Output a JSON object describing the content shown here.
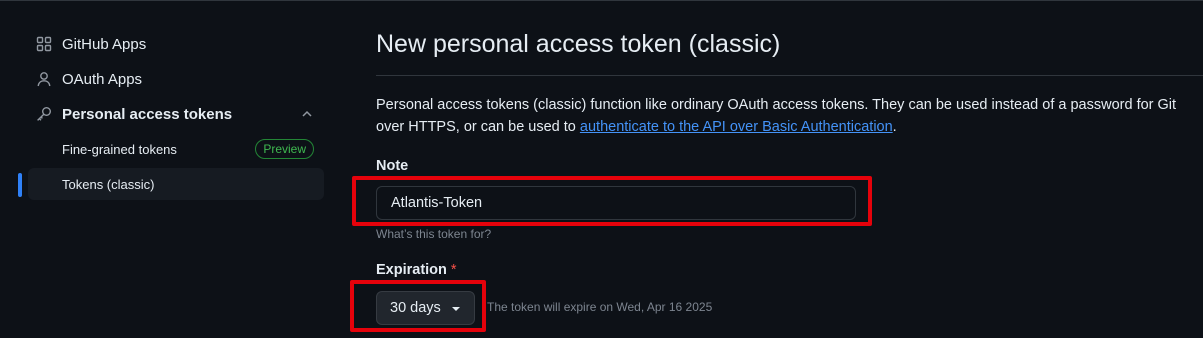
{
  "sidebar": {
    "items": [
      {
        "label": "GitHub Apps",
        "icon": "apps-grid-icon"
      },
      {
        "label": "OAuth Apps",
        "icon": "person-icon"
      },
      {
        "label": "Personal access tokens",
        "icon": "key-icon",
        "expanded": true
      }
    ],
    "subitems": [
      {
        "label": "Fine-grained tokens",
        "badge": "Preview"
      },
      {
        "label": "Tokens (classic)",
        "active": true
      }
    ]
  },
  "main": {
    "title": "New personal access token (classic)",
    "description_before": "Personal access tokens (classic) function like ordinary OAuth access tokens. They can be used instead of a password for Git over HTTPS, or can be used to ",
    "description_link": "authenticate to the API over Basic Authentication",
    "description_after": ".",
    "note": {
      "label": "Note",
      "value": "Atlantis-Token",
      "hint": "What’s this token for?"
    },
    "expiration": {
      "label": "Expiration",
      "required_marker": "*",
      "selected": "30 days",
      "note": "The token will expire on Wed, Apr 16 2025"
    }
  },
  "colors": {
    "background": "#0d1117",
    "accent": "#2f81f7",
    "link": "#4493f8",
    "highlight": "#e5020b",
    "badge": "#3fb950"
  }
}
